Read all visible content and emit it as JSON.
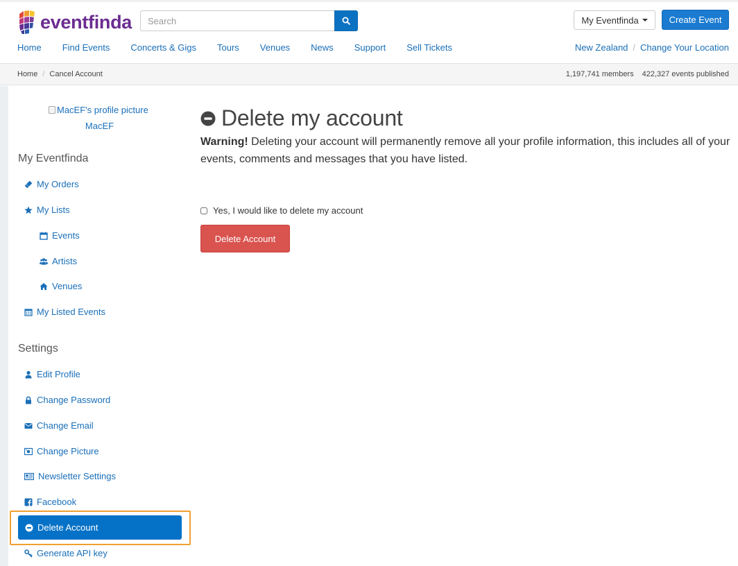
{
  "header": {
    "logo_text": "eventfinda",
    "search_placeholder": "Search",
    "my_eventfinda_label": "My Eventfinda",
    "create_event_label": "Create Event",
    "nav": [
      "Home",
      "Find Events",
      "Concerts & Gigs",
      "Tours",
      "Venues",
      "News",
      "Support",
      "Sell Tickets"
    ],
    "location": "New Zealand",
    "change_location": "Change Your Location"
  },
  "breadcrumb": {
    "items": [
      "Home",
      "Cancel Account"
    ],
    "members": "1,197,741 members",
    "events_published": "422,327 events published"
  },
  "sidebar": {
    "profile_alt": "MacEF's profile picture",
    "username": "MacEF",
    "my_eventfinda_heading": "My Eventfinda",
    "my_eventfinda_items": [
      {
        "label": "My Orders",
        "icon": "ticket-icon"
      },
      {
        "label": "My Lists",
        "icon": "star-icon"
      },
      {
        "label": "Events",
        "icon": "calendar-icon"
      },
      {
        "label": "Artists",
        "icon": "users-icon"
      },
      {
        "label": "Venues",
        "icon": "home-icon"
      },
      {
        "label": "My Listed Events",
        "icon": "calendar-grid-icon"
      }
    ],
    "settings_heading": "Settings",
    "settings_items": [
      {
        "label": "Edit Profile",
        "icon": "user-icon"
      },
      {
        "label": "Change Password",
        "icon": "lock-icon"
      },
      {
        "label": "Change Email",
        "icon": "envelope-icon"
      },
      {
        "label": "Change Picture",
        "icon": "picture-icon"
      },
      {
        "label": "Newsletter Settings",
        "icon": "newspaper-icon"
      },
      {
        "label": "Facebook",
        "icon": "facebook-icon"
      },
      {
        "label": "Delete Account",
        "icon": "minus-circle-icon"
      },
      {
        "label": "Generate API key",
        "icon": "key-icon"
      }
    ],
    "active_item": "Delete Account"
  },
  "main": {
    "title": "Delete my account",
    "warning_bold": "Warning!",
    "warning_text": " Deleting your account will permanently remove all your profile information, this includes all of your events, comments and messages that you have listed.",
    "confirm_label": "Yes, I would like to delete my account",
    "confirm_checked": false,
    "delete_button_label": "Delete Account"
  },
  "colors": {
    "link": "#1a6fb8",
    "brand_purple": "#6b2c91",
    "primary_blue": "#1a7bd0",
    "active_blue": "#0672c7",
    "danger_red": "#d9534f",
    "highlight_orange": "#f0a030"
  }
}
